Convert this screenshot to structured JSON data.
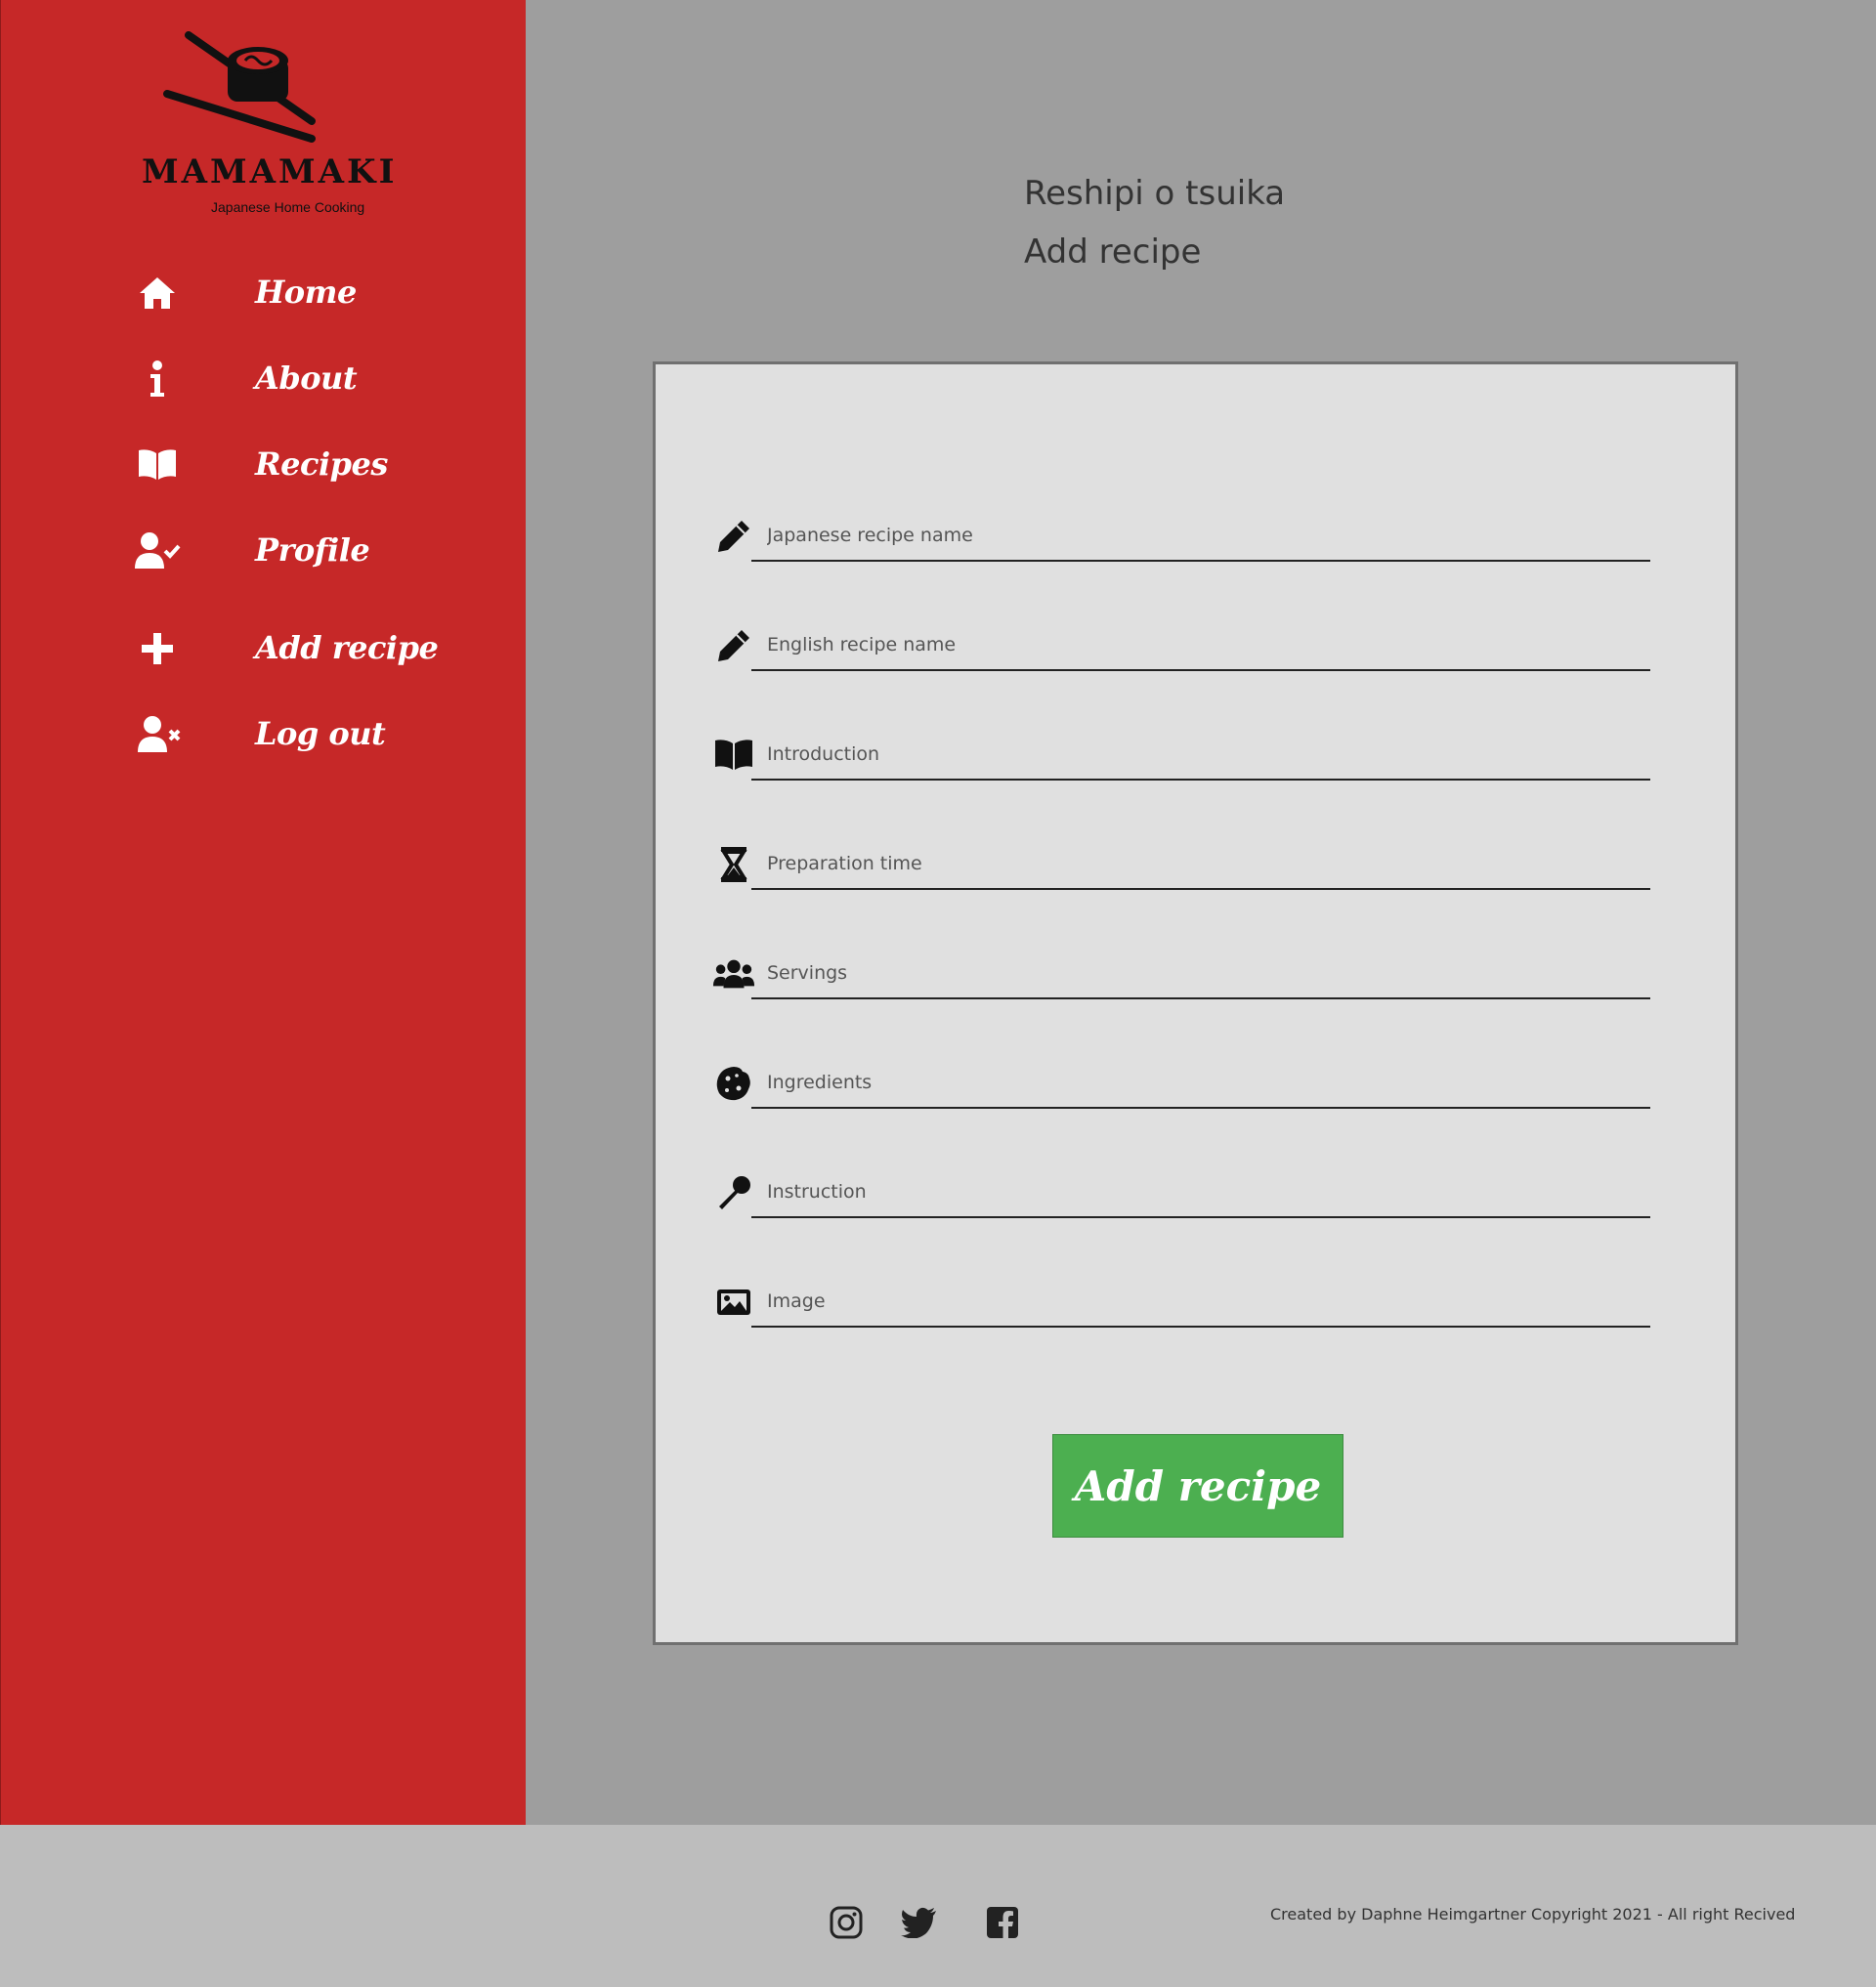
{
  "brand": {
    "name": "MAMAMAKI",
    "tagline": "Japanese Home Cooking"
  },
  "nav": {
    "items": [
      {
        "label": "Home",
        "icon": "home-icon"
      },
      {
        "label": "About",
        "icon": "info-icon"
      },
      {
        "label": "Recipes",
        "icon": "book-icon"
      },
      {
        "label": "Profile",
        "icon": "user-check-icon"
      },
      {
        "label": "Add recipe",
        "icon": "plus-icon"
      },
      {
        "label": "Log out",
        "icon": "user-times-icon"
      }
    ]
  },
  "page": {
    "title_jp": "Reshipi o tsuika",
    "title_en": "Add recipe"
  },
  "form": {
    "fields": [
      {
        "placeholder": "Japanese recipe name",
        "icon": "pencil-icon"
      },
      {
        "placeholder": "English recipe name",
        "icon": "pencil-icon"
      },
      {
        "placeholder": "Introduction",
        "icon": "book-icon"
      },
      {
        "placeholder": "Preparation time",
        "icon": "hourglass-icon"
      },
      {
        "placeholder": "Servings",
        "icon": "users-icon"
      },
      {
        "placeholder": "Ingredients",
        "icon": "cookie-icon"
      },
      {
        "placeholder": "Instruction",
        "icon": "spoon-icon"
      },
      {
        "placeholder": "Image",
        "icon": "image-icon"
      }
    ],
    "submit_label": "Add recipe"
  },
  "footer": {
    "social": [
      "instagram-icon",
      "twitter-icon",
      "facebook-icon"
    ],
    "copyright": "Created by Daphne Heimgartner Copyright 2021 - All right Recived"
  },
  "colors": {
    "sidebar": "#c62828",
    "main_bg": "#9e9e9e",
    "card_bg": "#e0e0e0",
    "button": "#4caf50",
    "footer": "#bdbdbd"
  }
}
